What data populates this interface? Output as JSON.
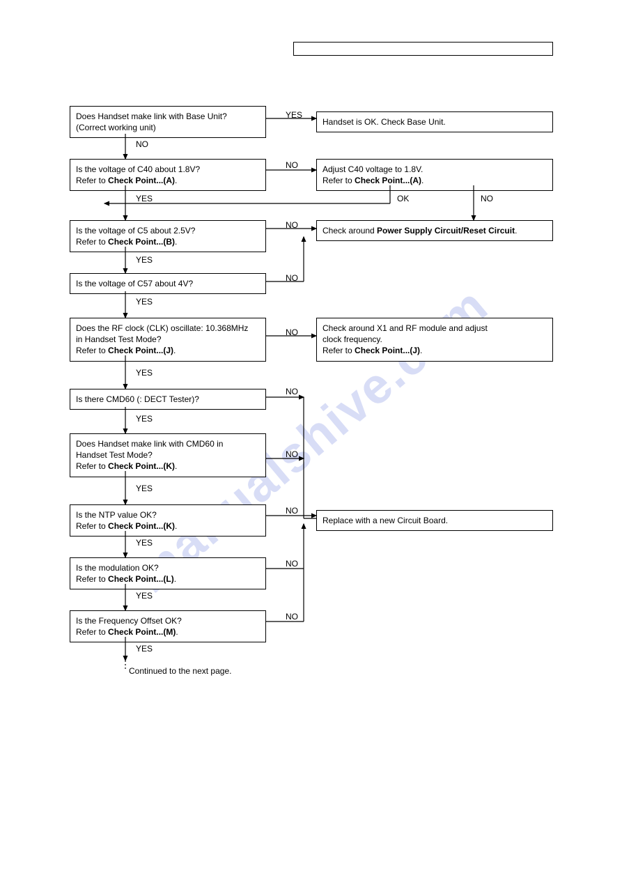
{
  "yes": "YES",
  "no": "NO",
  "ok": "OK",
  "continued": "Continued to the next page.",
  "watermark": "manualshive.com",
  "q1": {
    "l1": "Does Handset make link with Base Unit?",
    "l2": "(Correct working unit)"
  },
  "a1": "Handset is OK. Check Base Unit.",
  "q2": {
    "l1": "Is the voltage of C40 about 1.8V?",
    "l2a": "Refer to ",
    "l2b": "Check Point...(A)",
    "l2c": "."
  },
  "a2": {
    "l1": "Adjust C40 voltage to 1.8V.",
    "l2a": "Refer to ",
    "l2b": "Check Point...(A)",
    "l2c": "."
  },
  "q3": {
    "l1": "Is the voltage of C5 about 2.5V?",
    "l2a": "Refer to ",
    "l2b": "Check Point...(B)",
    "l2c": "."
  },
  "a3": {
    "pre": "Check around ",
    "b": "Power Supply Circuit/Reset Circuit",
    "post": "."
  },
  "q4": "Is the voltage of C57 about 4V?",
  "q5": {
    "l1": "Does the RF clock (CLK) oscillate: 10.368MHz",
    "l2": "in Handset Test Mode?",
    "l3a": "Refer to ",
    "l3b": "Check Point...(J)",
    "l3c": "."
  },
  "a5": {
    "l1": "Check around X1 and RF module and adjust",
    "l2": "clock frequency.",
    "l3a": "Refer to ",
    "l3b": "Check Point...(J)",
    "l3c": "."
  },
  "q6": "Is there CMD60 (: DECT Tester)?",
  "q7": {
    "l1": "Does Handset make link with CMD60 in",
    "l2": "Handset Test Mode?",
    "l3a": "Refer to ",
    "l3b": "Check Point...(K)",
    "l3c": "."
  },
  "q8": {
    "l1": "Is the NTP value OK?",
    "l2a": "Refer to ",
    "l2b": "Check Point...(K)",
    "l2c": "."
  },
  "a8": "Replace with a new Circuit Board.",
  "q9": {
    "l1": "Is the modulation OK?",
    "l2a": "Refer to ",
    "l2b": "Check Point...(L)",
    "l2c": "."
  },
  "q10": {
    "l1": "Is the Frequency Offset OK?",
    "l2a": "Refer to ",
    "l2b": "Check Point...(M)",
    "l2c": "."
  }
}
